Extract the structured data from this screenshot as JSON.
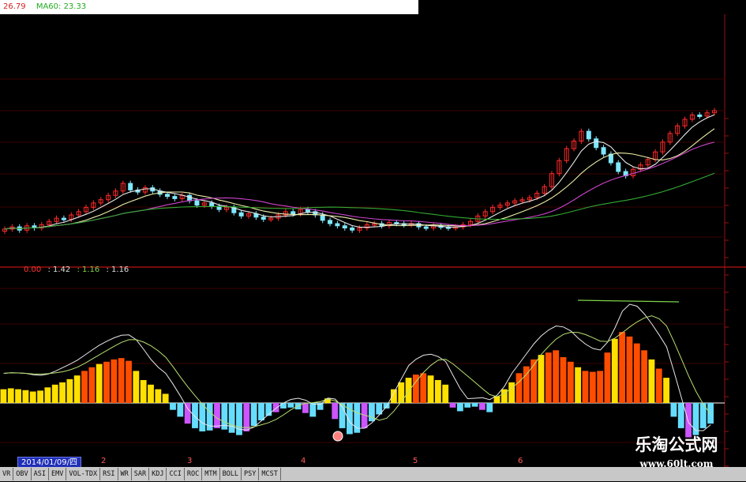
{
  "ma_header": [
    {
      "text": "26.79",
      "color": "#d42020"
    },
    {
      "text": "MA60: 23.33",
      "color": "#22aa22"
    }
  ],
  "indicator_values": [
    {
      "text": "0.00",
      "color": "#ff3333"
    },
    {
      "text": ": 1.42",
      "color": "#dddddd"
    },
    {
      "text": ": 1.16",
      "color": "#7fd34a"
    },
    {
      "text": ": 1.16",
      "color": "#dddddd"
    }
  ],
  "date_label": "2014/01/09/四",
  "month_labels": [
    "2",
    "3",
    "4",
    "5",
    "6"
  ],
  "tabs": [
    "VR",
    "OBV",
    "ASI",
    "EMV",
    "VOL-TDX",
    "RSI",
    "WR",
    "SAR",
    "KDJ",
    "CCI",
    "ROC",
    "MTM",
    "BOLL",
    "PSY",
    "MCST"
  ],
  "watermark": {
    "title": "乐淘公式网",
    "url": "www.60lt.com"
  },
  "colors": {
    "up": "#ff2a2a",
    "down": "#7fe8ff",
    "ma5": "#e8e8e8",
    "ma10": "#eeeeaa",
    "ma20": "#cc44cc",
    "ma60": "#33aa33",
    "bar_pos_hi": "#ff4d00",
    "bar_pos_lo": "#ffe000",
    "bar_neg_a": "#66ddff",
    "bar_neg_b": "#cc55ff",
    "divider": "#9a1010"
  },
  "candles": [
    17.1,
    17.3,
    17.0,
    17.4,
    17.2,
    17.5,
    17.8,
    18.1,
    18.0,
    18.4,
    18.7,
    19.1,
    19.5,
    19.8,
    20.2,
    20.6,
    21.3,
    20.7,
    20.5,
    20.9,
    20.6,
    20.3,
    20.1,
    19.9,
    20.2,
    19.7,
    19.3,
    19.5,
    19.2,
    18.9,
    19.1,
    18.6,
    18.3,
    18.5,
    18.2,
    18.0,
    18.1,
    18.4,
    18.7,
    18.5,
    18.9,
    18.7,
    18.4,
    17.9,
    17.6,
    17.4,
    17.2,
    17.0,
    17.2,
    17.5,
    17.6,
    17.4,
    17.7,
    17.6,
    17.5,
    17.6,
    17.3,
    17.2,
    17.4,
    17.3,
    17.2,
    17.3,
    17.5,
    17.8,
    18.3,
    18.7,
    19.1,
    19.3,
    19.5,
    19.7,
    19.8,
    20.0,
    20.4,
    21.0,
    22.2,
    23.4,
    24.5,
    25.2,
    26.1,
    25.4,
    24.6,
    24.0,
    23.2,
    22.4,
    22.0,
    22.6,
    23.0,
    23.5,
    24.2,
    25.1,
    25.9,
    26.6,
    27.2,
    27.6,
    27.5,
    27.8,
    28.0
  ],
  "histogram": [
    0.3,
    0.32,
    0.3,
    0.28,
    0.25,
    0.27,
    0.34,
    0.4,
    0.45,
    0.52,
    0.6,
    0.7,
    0.78,
    0.85,
    0.9,
    0.95,
    0.98,
    0.92,
    0.7,
    0.5,
    0.4,
    0.3,
    0.2,
    -0.15,
    -0.3,
    -0.45,
    -0.55,
    -0.62,
    -0.6,
    -0.55,
    -0.58,
    -0.65,
    -0.7,
    -0.62,
    -0.5,
    -0.38,
    -0.28,
    -0.2,
    -0.12,
    -0.1,
    -0.14,
    -0.22,
    -0.3,
    -0.15,
    0.1,
    -0.35,
    -0.55,
    -0.68,
    -0.65,
    -0.55,
    -0.4,
    -0.25,
    -0.12,
    0.3,
    0.45,
    0.55,
    0.62,
    0.65,
    0.6,
    0.5,
    0.4,
    -0.1,
    -0.18,
    -0.1,
    -0.08,
    -0.15,
    -0.2,
    0.15,
    0.3,
    0.45,
    0.65,
    0.8,
    0.95,
    1.05,
    1.1,
    1.15,
    1.0,
    0.9,
    0.78,
    0.7,
    0.68,
    0.7,
    1.1,
    1.4,
    1.55,
    1.45,
    1.3,
    1.15,
    0.95,
    0.75,
    0.55,
    -0.3,
    -0.55,
    -0.75,
    -0.7,
    -0.55,
    -0.45
  ]
}
